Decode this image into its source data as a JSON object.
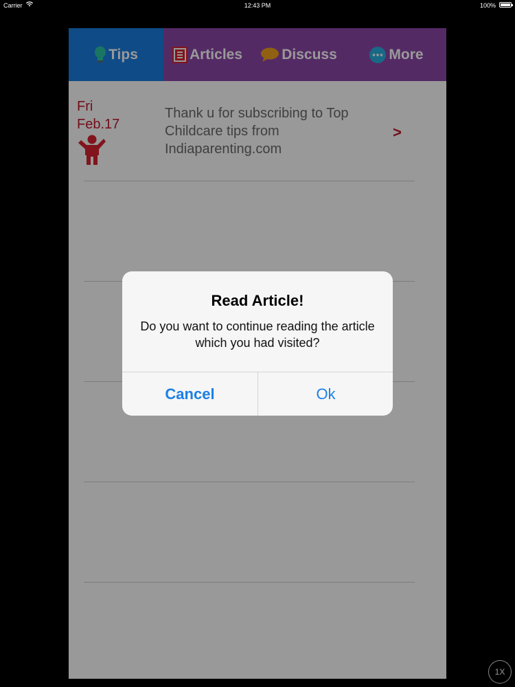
{
  "status_bar": {
    "carrier": "Carrier",
    "time": "12:43 PM",
    "battery": "100%"
  },
  "tabs": [
    {
      "label": "Tips",
      "icon": "lightbulb-icon",
      "active": true
    },
    {
      "label": "Articles",
      "icon": "article-icon",
      "active": false
    },
    {
      "label": "Discuss",
      "icon": "speech-bubble-icon",
      "active": false
    },
    {
      "label": "More",
      "icon": "more-dots-icon",
      "active": false
    }
  ],
  "list": {
    "items": [
      {
        "day": "Fri",
        "date": "Feb.17",
        "icon": "child-icon",
        "text": "Thank u for subscribing to Top Childcare tips from Indiaparenting.com",
        "chevron": ">"
      }
    ]
  },
  "alert": {
    "title": "Read Article!",
    "message": "Do you want to continue reading the article which you had visited?",
    "cancel_label": "Cancel",
    "ok_label": "Ok"
  },
  "scale_badge": "1X",
  "colors": {
    "tab_active": "#1a7ee0",
    "tab_bar": "#8c46a8",
    "accent_red": "#c01a2c",
    "alert_button": "#1b7fe6"
  }
}
